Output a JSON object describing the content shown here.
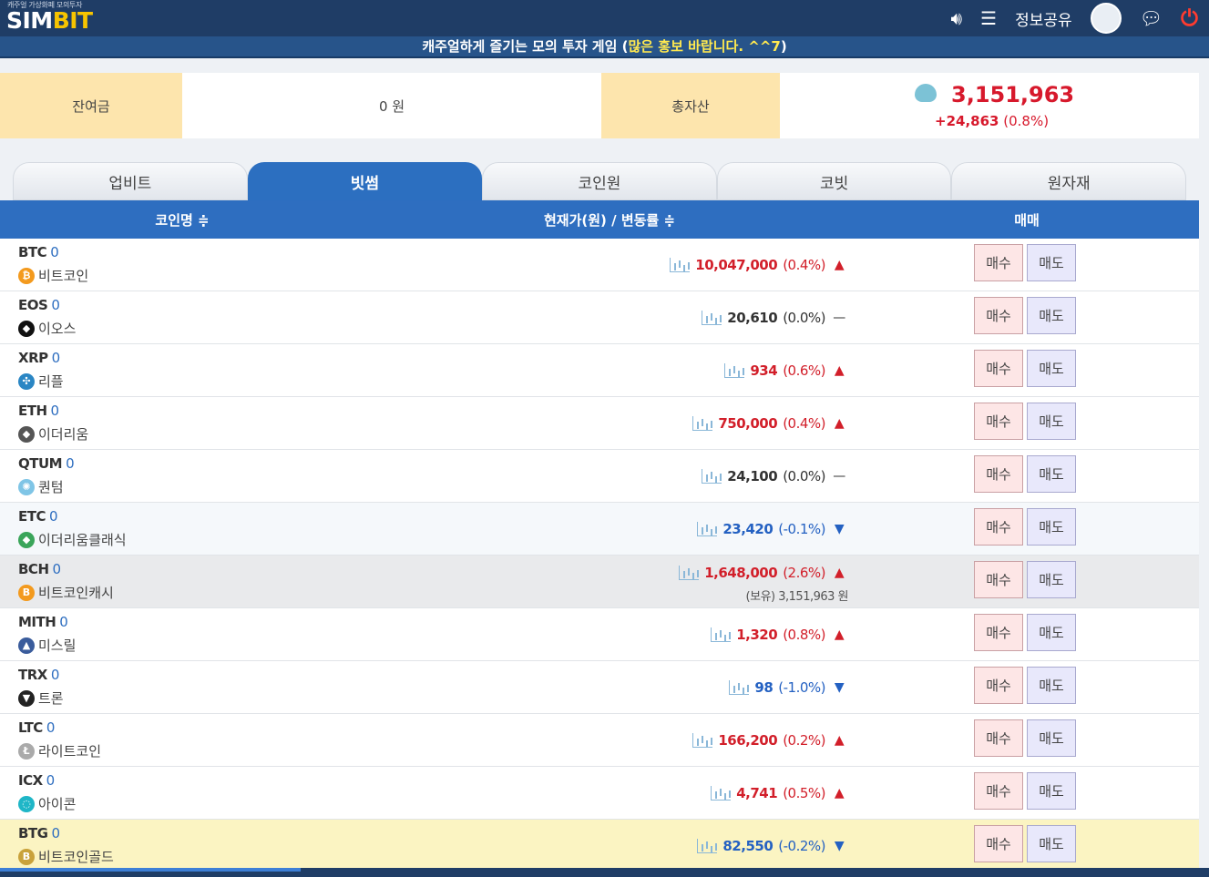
{
  "header": {
    "logo_small": "캐주얼 가상화폐 모의투자",
    "logo_sim": "SIM",
    "logo_bit": "BIT",
    "share_label": "정보공유",
    "icons": [
      "volume-icon",
      "menu-list-icon",
      "user-icon",
      "chat-icon",
      "power-icon"
    ]
  },
  "banner": {
    "text": "캐주얼하게 즐기는 모의 투자 게임 (",
    "highlight": "많은 홍보 바랍니다. ^^7",
    "end": ")"
  },
  "summary": {
    "balance_label": "잔여금",
    "balance_value": "0 원",
    "total_label": "총자산",
    "total_value": "3,151,963",
    "total_change": "+24,863",
    "total_change_pct": "(0.8%)"
  },
  "tabs": [
    "업비트",
    "빗썸",
    "코인원",
    "코빗",
    "원자재"
  ],
  "active_tab": 1,
  "table": {
    "col_name": "코인명 ≑",
    "col_price": "현재가(원) / 변동률 ≑",
    "col_trade": "매매"
  },
  "buy_label": "매수",
  "sell_label": "매도",
  "colors": {
    "up": "#d21f2a",
    "down": "#2461c2",
    "header": "#2e6ec0"
  },
  "rows": [
    {
      "symbol": "BTC",
      "count": "0",
      "name": "비트코인",
      "price": "10,047,000",
      "pct": "(0.4%)",
      "dir": "up",
      "icon": "bitcoin-icon",
      "bg": ""
    },
    {
      "symbol": "EOS",
      "count": "0",
      "name": "이오스",
      "price": "20,610",
      "pct": "(0.0%)",
      "dir": "flat",
      "icon": "eos-icon",
      "bg": ""
    },
    {
      "symbol": "XRP",
      "count": "0",
      "name": "리플",
      "price": "934",
      "pct": "(0.6%)",
      "dir": "up",
      "icon": "ripple-icon",
      "bg": ""
    },
    {
      "symbol": "ETH",
      "count": "0",
      "name": "이더리움",
      "price": "750,000",
      "pct": "(0.4%)",
      "dir": "up",
      "icon": "ethereum-icon",
      "bg": ""
    },
    {
      "symbol": "QTUM",
      "count": "0",
      "name": "퀀텀",
      "price": "24,100",
      "pct": "(0.0%)",
      "dir": "flat",
      "icon": "qtum-icon",
      "bg": ""
    },
    {
      "symbol": "ETC",
      "count": "0",
      "name": "이더리움클래식",
      "price": "23,420",
      "pct": "(-0.1%)",
      "dir": "down",
      "icon": "ethereum-classic-icon",
      "bg": "alt"
    },
    {
      "symbol": "BCH",
      "count": "0",
      "name": "비트코인캐시",
      "price": "1,648,000",
      "pct": "(2.6%)",
      "dir": "up",
      "icon": "bitcoin-cash-icon",
      "bg": "gray",
      "hold": "(보유) 3,151,963 원"
    },
    {
      "symbol": "MITH",
      "count": "0",
      "name": "미스릴",
      "price": "1,320",
      "pct": "(0.8%)",
      "dir": "up",
      "icon": "mithril-icon",
      "bg": ""
    },
    {
      "symbol": "TRX",
      "count": "0",
      "name": "트론",
      "price": "98",
      "pct": "(-1.0%)",
      "dir": "down",
      "icon": "tron-icon",
      "bg": ""
    },
    {
      "symbol": "LTC",
      "count": "0",
      "name": "라이트코인",
      "price": "166,200",
      "pct": "(0.2%)",
      "dir": "up",
      "icon": "litecoin-icon",
      "bg": ""
    },
    {
      "symbol": "ICX",
      "count": "0",
      "name": "아이콘",
      "price": "4,741",
      "pct": "(0.5%)",
      "dir": "up",
      "icon": "icon-coin-icon",
      "bg": ""
    },
    {
      "symbol": "BTG",
      "count": "0",
      "name": "비트코인골드",
      "price": "82,550",
      "pct": "(-0.2%)",
      "dir": "down",
      "icon": "bitcoin-gold-icon",
      "bg": "yellow"
    }
  ]
}
